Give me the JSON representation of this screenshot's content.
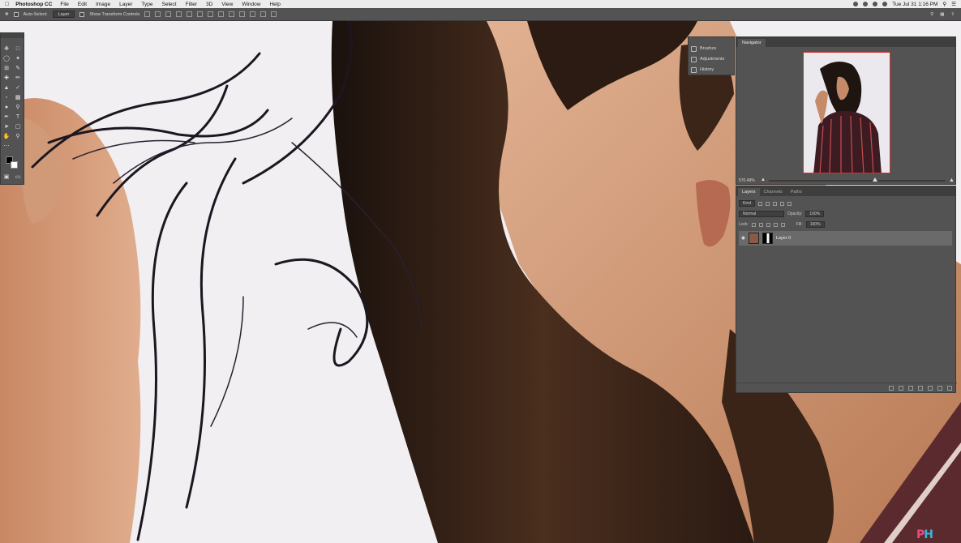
{
  "menubar": {
    "app": "Photoshop CC",
    "menus": [
      "File",
      "Edit",
      "Image",
      "Layer",
      "Type",
      "Select",
      "Filter",
      "3D",
      "View",
      "Window",
      "Help"
    ],
    "clock": "Tue Jul 31  1:16 PM"
  },
  "options": {
    "auto_select_label": "Auto-Select:",
    "auto_select_target": "Layer",
    "transform_label": "Show Transform Controls"
  },
  "dock": {
    "items": [
      "Brushes",
      "Adjustments",
      "History"
    ]
  },
  "navigator": {
    "tab": "Navigator",
    "zoom": "570.49%",
    "zoom_fraction": 0.6
  },
  "layers": {
    "tabs": [
      "Layers",
      "Channels",
      "Paths"
    ],
    "kind": "Kind",
    "blend_mode": "Normal",
    "opacity_label": "Opacity:",
    "opacity_value": "100%",
    "lock_label": "Lock:",
    "fill_label": "Fill:",
    "fill_value": "100%",
    "layer_name": "Layer 0"
  },
  "colors": {
    "panel": "#535353",
    "panel_dark": "#3e3e3e",
    "layer_selected": "#6a6a6a",
    "skin": "#c98d66",
    "hair": "#2a1a12"
  },
  "logo": {
    "part1": "P",
    "part2": "H"
  }
}
